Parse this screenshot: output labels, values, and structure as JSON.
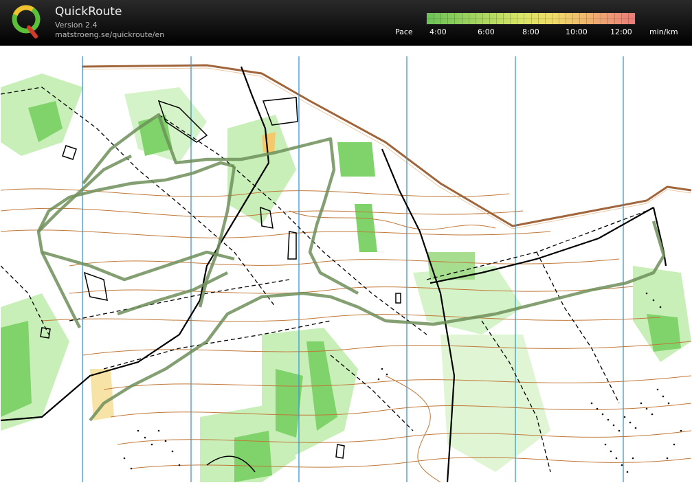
{
  "app": {
    "name": "QuickRoute",
    "version": "Version 2.4",
    "url": "matstroeng.se/quickroute/en"
  },
  "pace_legend": {
    "label": "Pace",
    "ticks": [
      "4:00",
      "6:00",
      "8:00",
      "10:00",
      "12:00"
    ],
    "unit": "min/km",
    "colors": [
      "#6cc05a",
      "#a6d65e",
      "#d9e466",
      "#eedc6a",
      "#efb470",
      "#ee7a78"
    ]
  },
  "map": {
    "route_color": "#6f8f5a",
    "forest_color": "#7fd36a",
    "light_forest_color": "#c8efb8",
    "contour_color": "#b8652a",
    "road_color": "#a0653a",
    "meridian_color": "#3399dd",
    "boundary_color": "#000000"
  }
}
